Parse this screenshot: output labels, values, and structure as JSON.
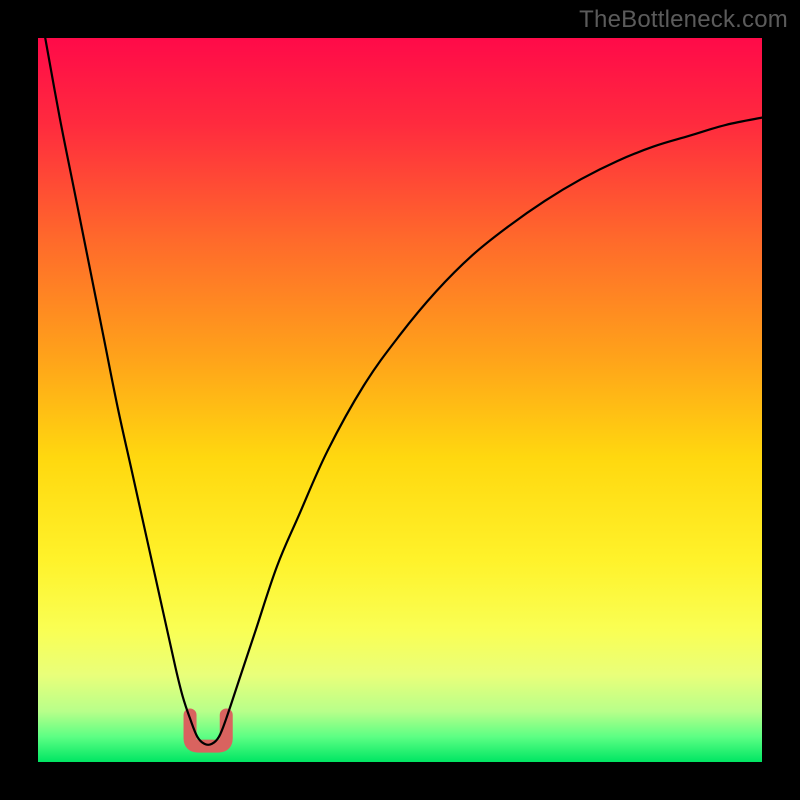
{
  "watermark": {
    "text": "TheBottleneck.com"
  },
  "gradient": {
    "stops": [
      {
        "offset": 0.0,
        "color": "#ff0a49"
      },
      {
        "offset": 0.12,
        "color": "#ff2b3e"
      },
      {
        "offset": 0.28,
        "color": "#ff6a2b"
      },
      {
        "offset": 0.44,
        "color": "#ffa21a"
      },
      {
        "offset": 0.58,
        "color": "#ffd80f"
      },
      {
        "offset": 0.72,
        "color": "#fff22a"
      },
      {
        "offset": 0.82,
        "color": "#f9ff55"
      },
      {
        "offset": 0.88,
        "color": "#e9ff7a"
      },
      {
        "offset": 0.93,
        "color": "#b8ff8a"
      },
      {
        "offset": 0.965,
        "color": "#5dff84"
      },
      {
        "offset": 1.0,
        "color": "#00e663"
      }
    ]
  },
  "chart_data": {
    "type": "line",
    "title": "",
    "xlabel": "",
    "ylabel": "",
    "xlim": [
      0,
      100
    ],
    "ylim": [
      0,
      100
    ],
    "grid": false,
    "legend": false,
    "series": [
      {
        "name": "bottleneck-curve",
        "x": [
          1,
          3,
          5,
          7,
          9,
          11,
          13,
          15,
          17,
          19,
          20,
          21,
          22,
          23,
          24,
          25,
          26,
          28,
          30,
          33,
          36,
          40,
          45,
          50,
          55,
          60,
          65,
          70,
          75,
          80,
          85,
          90,
          95,
          100
        ],
        "values": [
          100,
          89,
          79,
          69,
          59,
          49,
          40,
          31,
          22,
          13,
          9,
          6,
          3.5,
          2.5,
          2.5,
          3.5,
          6,
          12,
          18,
          27,
          34,
          43,
          52,
          59,
          65,
          70,
          74,
          77.5,
          80.5,
          83,
          85,
          86.5,
          88,
          89
        ]
      }
    ],
    "marker_region": {
      "name": "valley-marker",
      "color": "#d9635f",
      "x_range": [
        21,
        26
      ],
      "y_range": [
        2.2,
        6.5
      ]
    }
  }
}
